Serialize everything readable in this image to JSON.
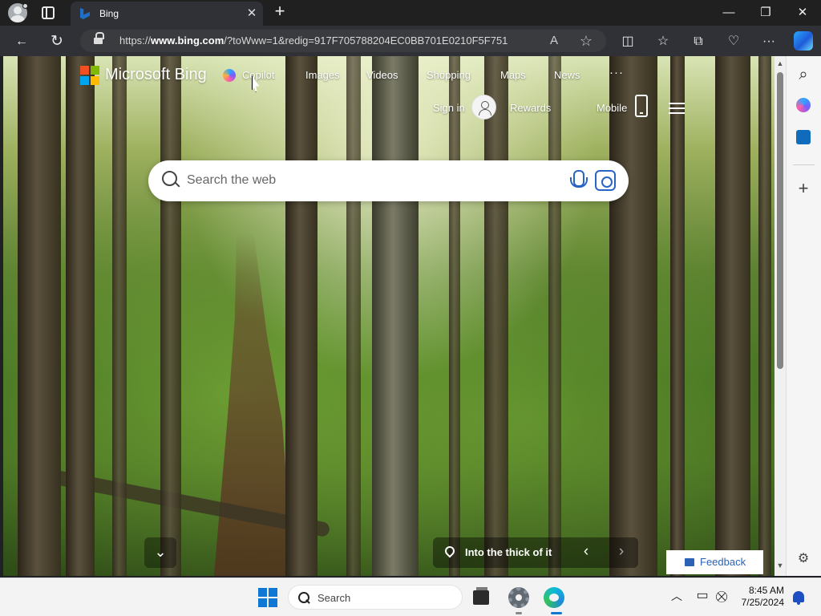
{
  "browser": {
    "tab_title": "Bing",
    "tab_close": "✕",
    "new_tab": "+",
    "window_controls": {
      "minimize": "—",
      "restore": "❐",
      "close": "✕"
    },
    "url_prefix": "https://",
    "url_domain": "www.bing.com",
    "url_rest": "/?toWww=1&redig=917F705788204EC0BB701E0210F5F751",
    "toolbar_icons": [
      "back-icon",
      "refresh-icon",
      "read-aloud-icon",
      "favorite-star-icon",
      "split-screen-icon",
      "favorites-icon",
      "collections-icon",
      "browser-essentials-icon",
      "more-icon",
      "copilot-icon"
    ],
    "toolbar_glyphs": {
      "back": "←",
      "refresh": "↻",
      "read_aloud": "A",
      "favorite": "☆",
      "split": "◫",
      "favorites": "☆",
      "collections": "⧉",
      "essentials": "♡",
      "more": "···"
    }
  },
  "bing": {
    "brand": "Microsoft Bing",
    "nav": [
      "Copilot",
      "Images",
      "Videos",
      "Shopping",
      "Maps",
      "News"
    ],
    "more": "···",
    "sign_in": "Sign in",
    "rewards": "Rewards",
    "mobile": "Mobile",
    "search": {
      "placeholder": "Search the web"
    },
    "scroll_down": "⌄",
    "image_caption": "Into the thick of it",
    "prev": "‹",
    "next": "›",
    "feedback": "Feedback",
    "logo_colors": [
      "#f25022",
      "#7fba00",
      "#00a4ef",
      "#ffb900"
    ]
  },
  "sidebar": {
    "glyphs": {
      "search": "⌕",
      "add": "+",
      "settings": "⚙"
    }
  },
  "taskbar": {
    "search_label": "Search",
    "tray_glyphs": {
      "chevron": "︿",
      "monitor": "▭",
      "network": "⛒"
    },
    "time": "8:45 AM",
    "date": "7/25/2024"
  },
  "colors": {
    "accent": "#2764c4",
    "titlebar": "#202020",
    "toolbar": "#2f3136"
  }
}
